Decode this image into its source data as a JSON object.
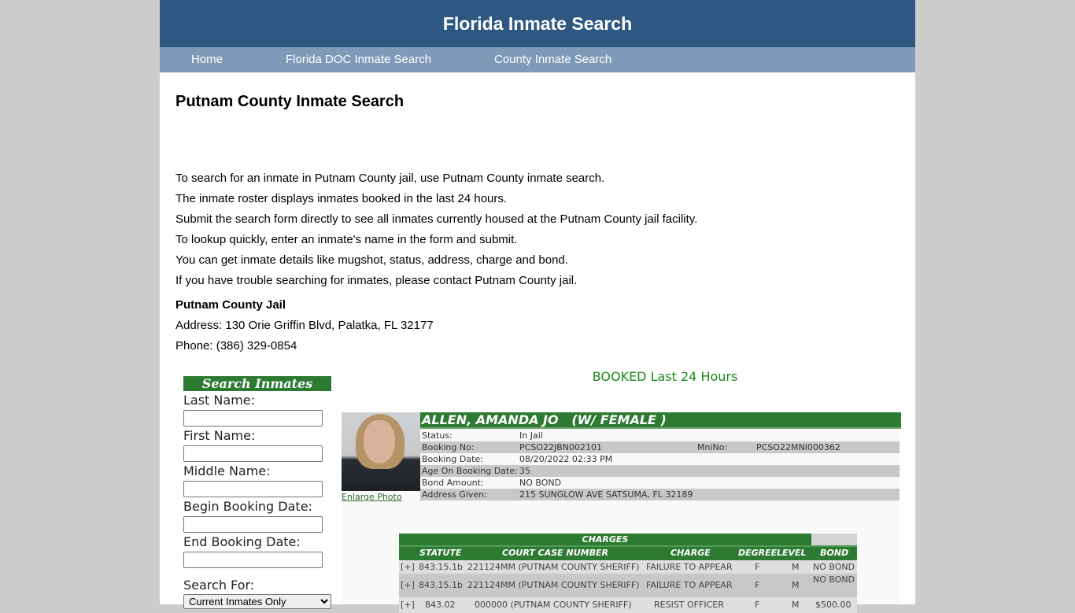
{
  "header": {
    "title": "Florida Inmate Search"
  },
  "nav": [
    {
      "label": "Home"
    },
    {
      "label": "Florida DOC Inmate Search"
    },
    {
      "label": "County Inmate Search"
    }
  ],
  "page_title": "Putnam County Inmate Search",
  "intro": [
    "To search for an inmate in Putnam County jail, use Putnam County inmate search.",
    "The inmate roster displays inmates booked in the last 24 hours.",
    "Submit the search form directly to see all inmates currently housed at the Putnam County jail facility.",
    "To lookup quickly, enter an inmate's name in the form and submit.",
    "You can get inmate details like mugshot, status, address, charge and bond.",
    "If you have trouble searching for inmates, please contact Putnam County jail."
  ],
  "jail": {
    "name": "Putnam County Jail",
    "address": "Address: 130 Orie Griffin Blvd, Palatka, FL 32177",
    "phone": "Phone: (386) 329-0854"
  },
  "search_form": {
    "title": "Search Inmates",
    "fields": [
      {
        "label": "Last Name:",
        "value": ""
      },
      {
        "label": "First Name:",
        "value": ""
      },
      {
        "label": "Middle Name:",
        "value": ""
      },
      {
        "label": "Begin Booking Date:",
        "value": ""
      },
      {
        "label": "End Booking Date:",
        "value": ""
      }
    ],
    "search_for_label": "Search For:",
    "search_for_value": "Current Inmates Only"
  },
  "booked_heading": "BOOKED Last 24 Hours",
  "inmate": {
    "name": "ALLEN, AMANDA JO   (W/ FEMALE )",
    "enlarge_photo": "Enlarge Photo",
    "rows": [
      {
        "key": "Status:",
        "value": "In Jail"
      },
      {
        "key": "Booking No:",
        "value": "PCSO22JBN002101",
        "key2": "MniNo:",
        "value2": "PCSO22MNI000362"
      },
      {
        "key": "Booking Date:",
        "value": "08/20/2022 02:33 PM"
      },
      {
        "key": "Age On Booking Date:",
        "value": "35"
      },
      {
        "key": "Bond Amount:",
        "value": "NO BOND"
      },
      {
        "key": "Address Given:",
        "value": "215 SUNGLOW AVE SATSUMA, FL 32189"
      }
    ]
  },
  "charges": {
    "title": "CHARGES",
    "columns": [
      "STATUTE",
      "COURT CASE NUMBER",
      "CHARGE",
      "DEGREE",
      "LEVEL",
      "BOND"
    ],
    "rows": [
      {
        "expand": "[+]",
        "statute": "843.15.1b",
        "case": "221124MM (PUTNAM COUNTY SHERIFF)",
        "charge": "FAILURE TO APPEAR",
        "degree": "F",
        "level": "M",
        "bond": "NO BOND"
      },
      {
        "expand": "[+]",
        "statute": "843.15.1b",
        "case": "221124MM (PUTNAM COUNTY SHERIFF)",
        "charge": "FAILURE TO APPEAR",
        "degree": "F",
        "level": "M",
        "bond": "NO BOND"
      },
      {
        "expand": "[+]",
        "statute": "843.02",
        "case": "000000 (PUTNAM COUNTY SHERIFF)",
        "charge": "RESIST OFFICER",
        "degree": "F",
        "level": "M",
        "bond": "$500.00"
      }
    ]
  }
}
